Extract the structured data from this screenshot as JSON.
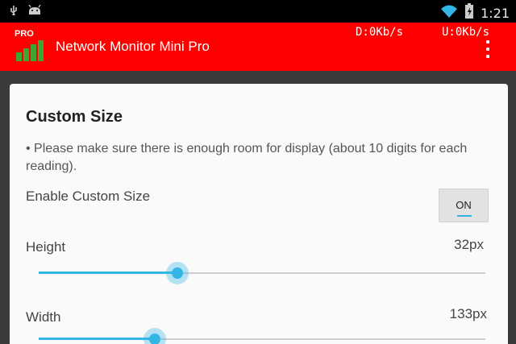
{
  "status_bar": {
    "time": "1:21",
    "icons": [
      "usb-icon",
      "android-icon",
      "wifi-icon",
      "battery-icon"
    ]
  },
  "app_bar": {
    "badge": "PRO",
    "title": "Network Monitor Mini Pro",
    "download_rate": "D:0Kb/s",
    "upload_rate": "U:0Kb/s",
    "menu_icon": "overflow-menu-icon"
  },
  "dialog": {
    "title": "Custom Size",
    "note": "• Please make sure there is enough room for display (about 10 digits for each reading).",
    "enable_label": "Enable Custom Size",
    "toggle_label": "ON",
    "height_label": "Height",
    "height_value": "32px",
    "height_fraction": 0.31,
    "width_label": "Width",
    "width_value": "133px",
    "width_fraction": 0.26
  },
  "colors": {
    "app_bar": "#ff0000",
    "accent": "#33b5e5",
    "status_bar": "#000000"
  }
}
